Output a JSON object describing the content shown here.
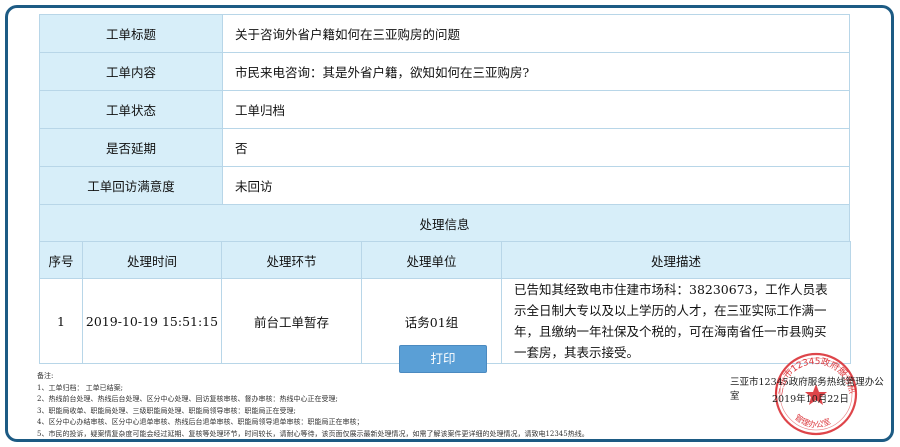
{
  "info_rows": [
    {
      "label": "工单标题",
      "value": "关于咨询外省户籍如何在三亚购房的问题"
    },
    {
      "label": "工单内容",
      "value": "市民来电咨询：其是外省户籍，欲知如何在三亚购房?"
    },
    {
      "label": "工单状态",
      "value": "工单归档"
    },
    {
      "label": "是否延期",
      "value": "否"
    },
    {
      "label": "工单回访满意度",
      "value": "未回访"
    }
  ],
  "section_title": "处理信息",
  "proc_headers": [
    "序号",
    "处理时间",
    "处理环节",
    "处理单位",
    "处理描述"
  ],
  "proc_rows": [
    {
      "seq": "1",
      "time": "2019-10-19 15:51:15",
      "step": "前台工单暂存",
      "unit": "话务01组",
      "desc": "已告知其经致电市住建市场科：38230673，工作人员表示全日制大专以及以上学历的人才，在三亚实际工作满一年，且缴纳一年社保及个税的，可在海南省任一市县购买一套房，其表示接受。"
    }
  ],
  "print_label": "打印",
  "notes": {
    "title": "备注:",
    "lines": [
      "1、工单归档：  工单已结案;",
      "2、热线前台处理、热线后台处理、区分中心处理、回访复核审核、督办审核：热线中心正在受理;",
      "3、职能局收单、职能局处理、三级职能局处理、职能局领导审核：职能局正在受理;",
      "4、区分中心办结审核、区分中心退单审核、热线后台退单审核、职能局领导退单审核：职能局正在审核；",
      "5、市民的投诉，疑案情复杂度可能会经过延期、复核等处理环节，时间较长，请耐心等待，该页面仅展示最新处理情况，如需了解该案件更详细的处理情况，请致电12345热线。"
    ]
  },
  "office_name": "三亚市12345政府服务热线管理办公室",
  "office_date": "2019年10月22日",
  "seal": {
    "color": "#d8242a",
    "top_text": "三亚市12345政府服务热线",
    "bottom_text": "管理办公室"
  }
}
